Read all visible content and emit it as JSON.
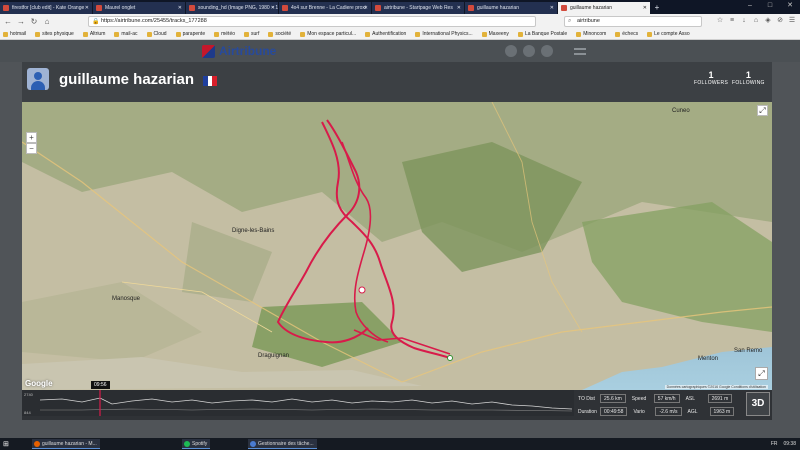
{
  "browser": {
    "tabs": [
      {
        "label": "firestfor [club edit] - Kate Orange"
      },
      {
        "label": "Maurel onglet"
      },
      {
        "label": "sounding_hd (Image PNG, 1980 × 1"
      },
      {
        "label": "4x4 sur Brenne - La Cadiere proxi"
      },
      {
        "label": "airtribune - Startpage Web Res"
      },
      {
        "label": "guillaume hazarian"
      },
      {
        "label": "guillaume hazarian"
      }
    ],
    "url": "https://airtribune.com/25455/tracks_177288",
    "search_value": "airtribune",
    "bookmarks": [
      "hotmail",
      "sites physique",
      "Altrium",
      "mail-ac",
      "Cloud",
      "parapente",
      "météo",
      "surf",
      "société",
      "Mon espace particul...",
      "Authentification",
      "International Physics...",
      "Maxeeny",
      "La Banque Postale",
      "Minoncom",
      "échecs",
      "Le compte Asso"
    ]
  },
  "site": {
    "logo_text": "Airtribune"
  },
  "profile": {
    "name": "guillaume hazarian",
    "followers_count": "1",
    "followers_label": "FOLLOWERS",
    "following_count": "1",
    "following_label": "FOLLOWING"
  },
  "map": {
    "attribution": "Données cartographiques ©2016 Google    Conditions d'utilisation",
    "places": [
      {
        "name": "Cuneo"
      },
      {
        "name": "Manosque"
      },
      {
        "name": "Menton"
      },
      {
        "name": "San Remo"
      },
      {
        "name": "Draguignan"
      },
      {
        "name": "Digne-les-Bains"
      }
    ]
  },
  "track": {
    "time_marker": "09:56",
    "elev_top_label": "2740",
    "elev_bottom_label": "844",
    "to_dist_label": "TO Dist",
    "to_dist_value": "25.6 km",
    "speed_label": "Speed",
    "speed_value": "57 km/h",
    "asl_label": "ASL",
    "asl_value": "2691 m",
    "duration_label": "Duration",
    "duration_value": "00:49:58",
    "vario_label": "Vario",
    "vario_value": "-2.6 m/s",
    "agl_label": "AGL",
    "agl_value": "1963 m",
    "view_3d_label": "3D"
  },
  "taskbar": {
    "items": [
      "guillaume hazarian - M...",
      "Spotify",
      "Gestionnaire des tâche..."
    ],
    "lang": "FR",
    "clock": "09:38"
  },
  "colors": {
    "track": "#d81b4a",
    "brand_red": "#c4172b",
    "brand_blue": "#274a9c"
  }
}
